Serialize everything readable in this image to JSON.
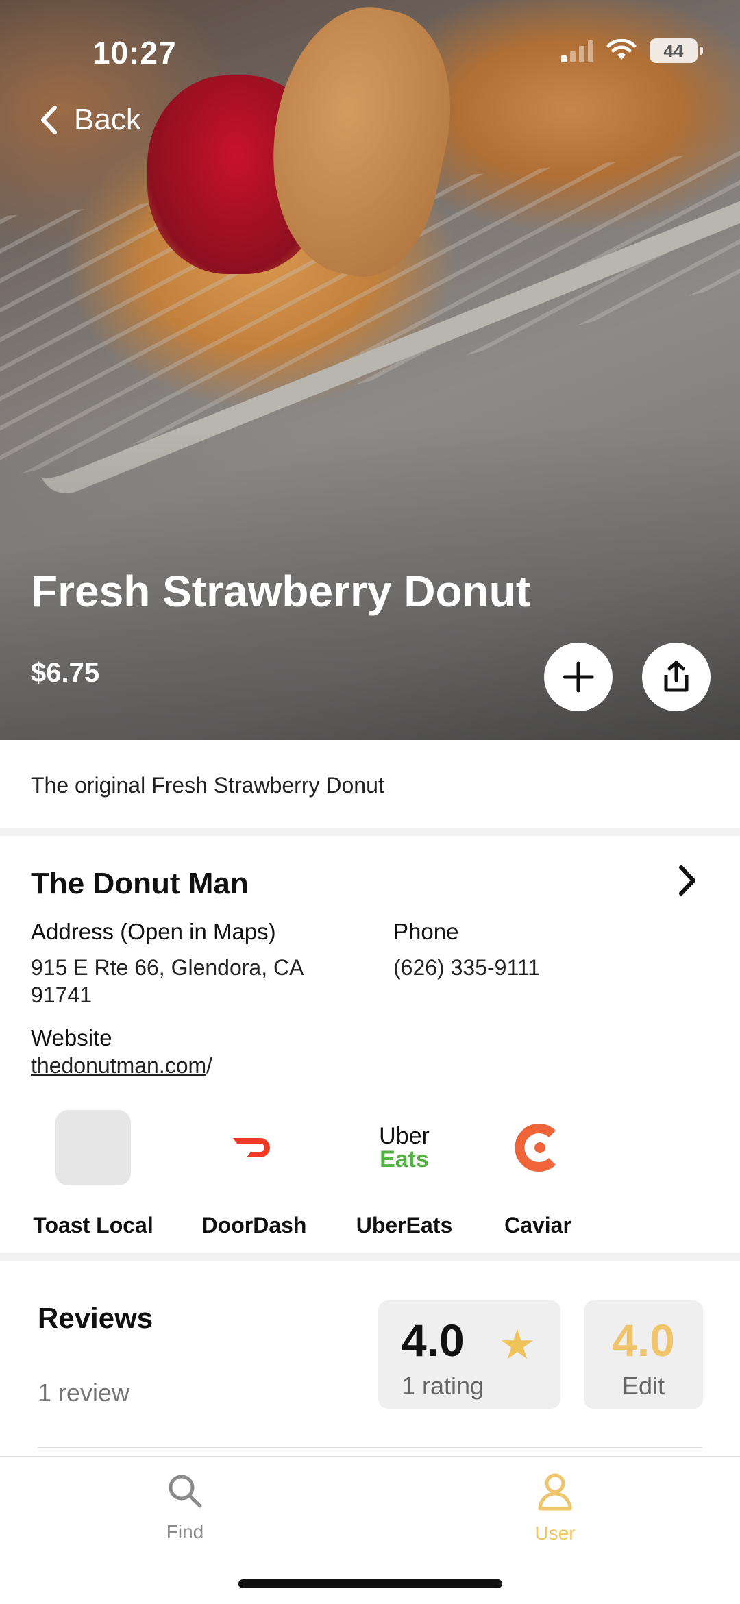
{
  "status_bar": {
    "time": "10:27",
    "battery": "44"
  },
  "nav": {
    "back_label": "Back"
  },
  "item": {
    "title": "Fresh Strawberry Donut",
    "price": "$6.75",
    "description": "The original Fresh Strawberry Donut"
  },
  "vendor": {
    "name": "The Donut Man",
    "address_label": "Address (Open in Maps)",
    "address_line1": "915 E Rte 66, Glendora, CA",
    "address_line2": "91741",
    "phone_label": "Phone",
    "phone": "(626) 335-9111",
    "website_label": "Website",
    "website_link": "thedonutman.com",
    "website_suffix": "/"
  },
  "services": [
    {
      "label": "Toast Local",
      "icon": "toast-placeholder"
    },
    {
      "label": "DoorDash",
      "icon": "doordash-logo",
      "color": "#ef3a24"
    },
    {
      "label": "UberEats",
      "icon": "ubereats-logo",
      "logo_line1": "Uber",
      "logo_line2": "Eats",
      "color": "#52b043"
    },
    {
      "label": "Caviar",
      "icon": "caviar-logo",
      "color": "#f0643a"
    }
  ],
  "reviews": {
    "title": "Reviews",
    "count": "1 review",
    "rating": "4.0",
    "rating_sub": "1 rating",
    "my_rating": "4.0",
    "edit_label": "Edit"
  },
  "tabbar": {
    "find_label": "Find",
    "user_label": "User",
    "active_color": "#efc46a"
  }
}
